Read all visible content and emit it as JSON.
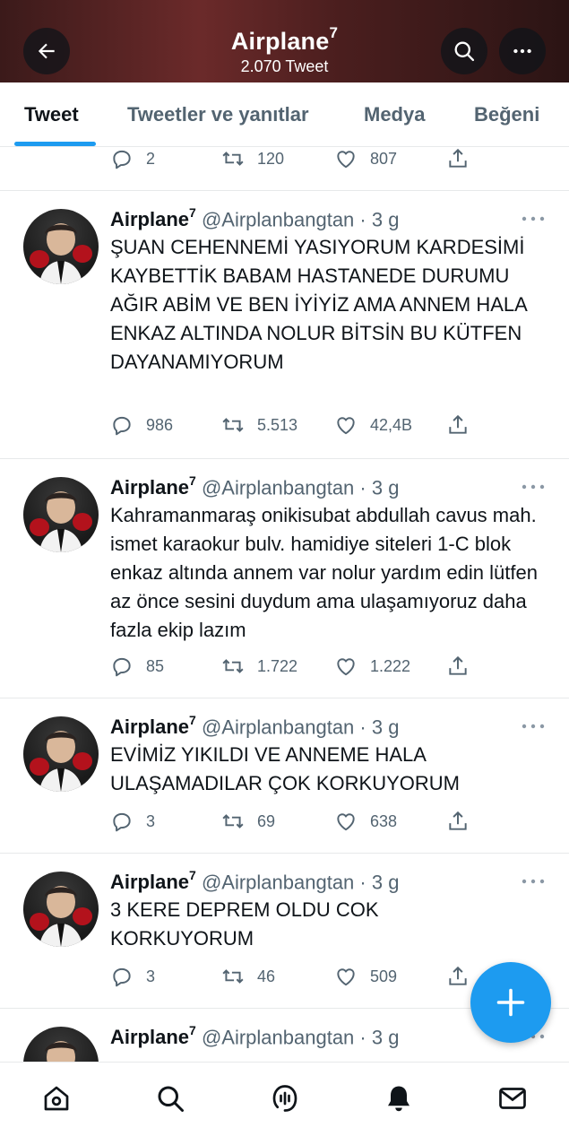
{
  "header": {
    "title": "Airplane",
    "title_mark": "7",
    "subtitle": "2.070 Tweet"
  },
  "tabs": [
    {
      "label": "Tweet",
      "active": true
    },
    {
      "label": "Tweetler ve yanıtlar",
      "active": false
    },
    {
      "label": "Medya",
      "active": false
    },
    {
      "label": "Beğeni",
      "active": false
    }
  ],
  "partial_tweet": {
    "replies": "2",
    "retweets": "120",
    "likes": "807"
  },
  "tweets": [
    {
      "name": "Airplane",
      "name_mark": "7",
      "handle": "@Airplanbangtan",
      "time": "3 g",
      "text": "ŞUAN CEHENNEMİ YASIYORUM KARDESİMİ KAYBETTİK BABAM HASTANEDE DURUMU AĞIR ABİM VE BEN İYİYİZ AMA ANNEM HALA ENKAZ ALTINDA NOLUR BİTSİN BU KÜTFEN DAYANAMIYORUM",
      "replies": "986",
      "retweets": "5.513",
      "likes": "42,4B"
    },
    {
      "name": "Airplane",
      "name_mark": "7",
      "handle": "@Airplanbangtan",
      "time": "3 g",
      "text": "Kahramanmaraş onikisubat abdullah cavus mah. ismet karaokur bulv. hamidiye siteleri 1-C blok enkaz altında annem var nolur yardım edin lütfen az önce sesini duydum ama ulaşamıyoruz daha fazla ekip lazım",
      "replies": "85",
      "retweets": "1.722",
      "likes": "1.222"
    },
    {
      "name": "Airplane",
      "name_mark": "7",
      "handle": "@Airplanbangtan",
      "time": "3 g",
      "text": "EVİMİZ YIKILDI VE ANNEME HALA ULAŞAMADILAR ÇOK KORKUYORUM",
      "replies": "3",
      "retweets": "69",
      "likes": "638"
    },
    {
      "name": "Airplane",
      "name_mark": "7",
      "handle": "@Airplanbangtan",
      "time": "3 g",
      "text": "3 KERE DEPREM OLDU COK KORKUYORUM",
      "replies": "3",
      "retweets": "46",
      "likes": "509"
    },
    {
      "name": "Airplane",
      "name_mark": "7",
      "handle": "@Airplanbangtan",
      "time": "3 g"
    }
  ],
  "icons": {
    "back": "arrow-left-icon",
    "search": "search-icon",
    "more": "more-icon",
    "reply": "reply-icon",
    "retweet": "retweet-icon",
    "like": "heart-icon",
    "share": "share-icon",
    "compose": "plus-icon",
    "nav": [
      "home-icon",
      "explore-icon",
      "spaces-icon",
      "notifications-icon",
      "messages-icon"
    ]
  },
  "colors": {
    "accent": "#1d9bf0",
    "text": "#0f1419",
    "muted": "#536471"
  }
}
